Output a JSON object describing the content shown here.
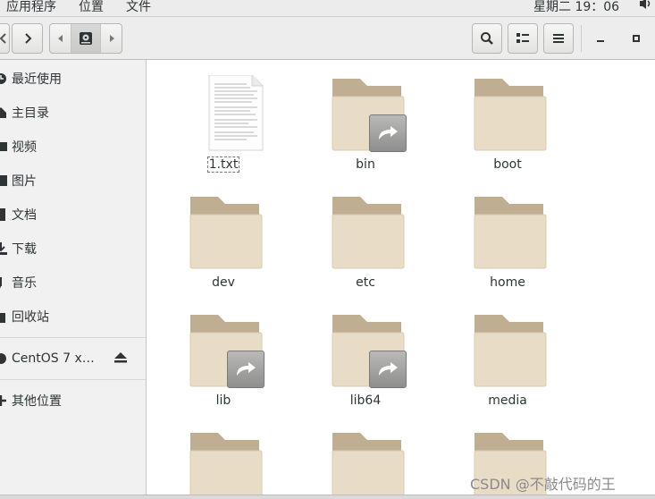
{
  "topbar": {
    "applications": "应用程序",
    "places": "位置",
    "file": "文件",
    "clock": "星期二 19：06",
    "volume_icon": "speaker-icon"
  },
  "header": {
    "back_icon": "chevron-left-icon",
    "forward_icon": "chevron-right-icon",
    "path_prev_icon": "triangle-left-icon",
    "path_next_icon": "triangle-right-icon",
    "path_root_icon": "hard-disk-icon",
    "search_icon": "search-icon",
    "view_icon": "list-view-icon",
    "menu_icon": "hamburger-menu-icon",
    "minimize_icon": "minimize-icon",
    "maximize_icon": "maximize-icon"
  },
  "sidebar": {
    "items": [
      {
        "label": "最近使用",
        "icon": "clock-icon"
      },
      {
        "label": "主目录",
        "icon": "home-icon"
      },
      {
        "label": "视频",
        "icon": "video-icon"
      },
      {
        "label": "图片",
        "icon": "picture-icon"
      },
      {
        "label": "文档",
        "icon": "document-icon"
      },
      {
        "label": "下载",
        "icon": "download-icon"
      },
      {
        "label": "音乐",
        "icon": "music-icon"
      },
      {
        "label": "回收站",
        "icon": "trash-icon"
      }
    ],
    "device": {
      "label": "CentOS 7 x…",
      "icon": "disc-icon",
      "eject_icon": "eject-icon"
    },
    "other": {
      "label": "其他位置",
      "icon": "plus-icon"
    }
  },
  "files": [
    {
      "name": "1.txt",
      "type": "text"
    },
    {
      "name": "bin",
      "type": "folder-link"
    },
    {
      "name": "boot",
      "type": "folder"
    },
    {
      "name": "dev",
      "type": "folder"
    },
    {
      "name": "etc",
      "type": "folder"
    },
    {
      "name": "home",
      "type": "folder"
    },
    {
      "name": "lib",
      "type": "folder-link"
    },
    {
      "name": "lib64",
      "type": "folder-link"
    },
    {
      "name": "media",
      "type": "folder"
    },
    {
      "name": "",
      "type": "folder"
    },
    {
      "name": "",
      "type": "folder"
    },
    {
      "name": "",
      "type": "folder"
    }
  ],
  "watermark": "CSDN @不敲代码的王"
}
